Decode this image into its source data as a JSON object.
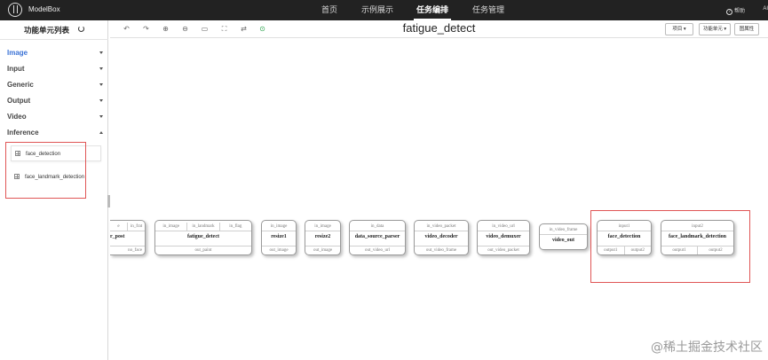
{
  "app": {
    "brand": "ModelBox"
  },
  "nav": {
    "tabs": [
      {
        "label": "首页"
      },
      {
        "label": "示例展示"
      },
      {
        "label": "任务编排"
      },
      {
        "label": "任务管理"
      }
    ],
    "active_tab": "任务编排",
    "help_label": "帮助",
    "user_label": "AI"
  },
  "sidebar": {
    "title": "功能单元列表",
    "categories": [
      {
        "label": "Image",
        "expanded": false
      },
      {
        "label": "Input",
        "expanded": false
      },
      {
        "label": "Generic",
        "expanded": false
      },
      {
        "label": "Output",
        "expanded": false
      },
      {
        "label": "Video",
        "expanded": false
      },
      {
        "label": "Inference",
        "expanded": true
      }
    ],
    "inference_items": [
      {
        "label": "face_detection"
      },
      {
        "label": "face_landmark_detection"
      }
    ]
  },
  "toolbar": {
    "title": "fatigue_detect",
    "buttons": [
      {
        "label": "项目 ▾"
      },
      {
        "label": "功能单元 ▾"
      },
      {
        "label": "图属性"
      }
    ],
    "tool_icons": [
      "undo-icon",
      "redo-icon",
      "zoom-in-icon",
      "zoom-out-icon",
      "fit-icon",
      "fullscreen-icon",
      "layout-icon",
      "run-icon"
    ]
  },
  "canvas": {
    "nodes": [
      {
        "name": "r_post",
        "inputs": [
          "e",
          "in_frat"
        ],
        "outputs": [
          "no_face"
        ],
        "clipped": true
      },
      {
        "name": "fatigue_detect",
        "inputs": [
          "in_image",
          "in_landmark",
          "in_flag"
        ],
        "outputs": [
          "out_paint"
        ]
      },
      {
        "name": "resize1",
        "inputs": [
          "in_image"
        ],
        "outputs": [
          "out_image"
        ]
      },
      {
        "name": "resize2",
        "inputs": [
          "in_image"
        ],
        "outputs": [
          "out_image"
        ]
      },
      {
        "name": "data_source_parser",
        "inputs": [
          "in_data"
        ],
        "outputs": [
          "out_video_url"
        ]
      },
      {
        "name": "video_decoder",
        "inputs": [
          "in_video_packet"
        ],
        "outputs": [
          "out_video_frame"
        ]
      },
      {
        "name": "video_demuxer",
        "inputs": [
          "in_video_url"
        ],
        "outputs": [
          "out_video_packet"
        ]
      },
      {
        "name": "video_out",
        "inputs": [
          "in_video_frame"
        ],
        "outputs": []
      },
      {
        "name": "face_detection",
        "inputs": [
          "input1"
        ],
        "outputs": [
          "output1",
          "output2"
        ]
      },
      {
        "name": "face_landmark_detection",
        "inputs": [
          "input2"
        ],
        "outputs": [
          "output1",
          "output2"
        ]
      }
    ]
  },
  "watermark": "@稀土掘金技术社区",
  "colors": {
    "nav_bg": "#222222",
    "accent": "#3c73d6",
    "annotation": "#e05555",
    "run": "#2ea44f"
  }
}
